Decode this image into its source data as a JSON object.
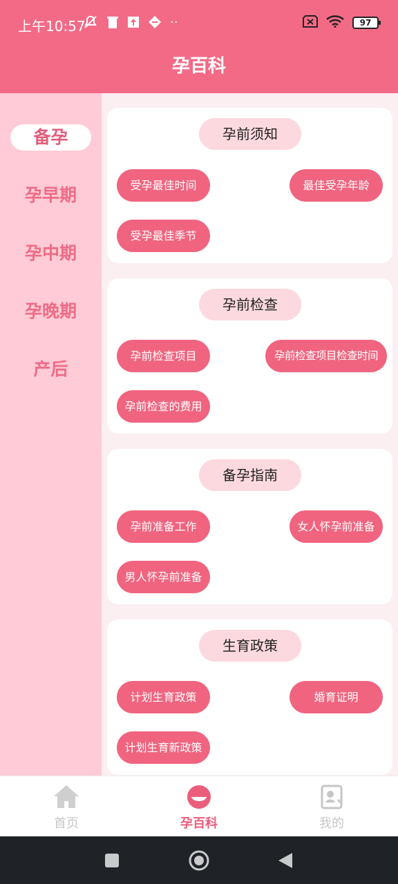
{
  "status_bar": {
    "time": "上午10:57",
    "battery": "97"
  },
  "header": {
    "title": "孕百科"
  },
  "sidebar": {
    "items": [
      {
        "label": "备孕",
        "active": true
      },
      {
        "label": "孕早期",
        "active": false
      },
      {
        "label": "孕中期",
        "active": false
      },
      {
        "label": "孕晚期",
        "active": false
      },
      {
        "label": "产后",
        "active": false
      }
    ]
  },
  "sections": [
    {
      "title": "孕前须知",
      "tags": [
        "受孕最佳时间",
        "最佳受孕年龄",
        "受孕最佳季节"
      ]
    },
    {
      "title": "孕前检查",
      "tags": [
        "孕前检查项目",
        "孕前检查项目检查时间",
        "孕前检查的费用"
      ]
    },
    {
      "title": "备孕指南",
      "tags": [
        "孕前准备工作",
        "女人怀孕前准备",
        "男人怀孕前准备"
      ]
    },
    {
      "title": "生育政策",
      "tags": [
        "计划生育政策",
        "婚育证明",
        "计划生育新政策"
      ]
    }
  ],
  "tabbar": {
    "items": [
      {
        "label": "首页",
        "icon": "home-icon"
      },
      {
        "label": "孕百科",
        "icon": "pregnancy-icon",
        "active": true
      },
      {
        "label": "我的",
        "icon": "profile-icon"
      }
    ]
  },
  "colors": {
    "primary": "#f36a86",
    "sidebar": "#fecbd6",
    "tag": "#f0647f",
    "title_pill": "#fcd9df"
  }
}
